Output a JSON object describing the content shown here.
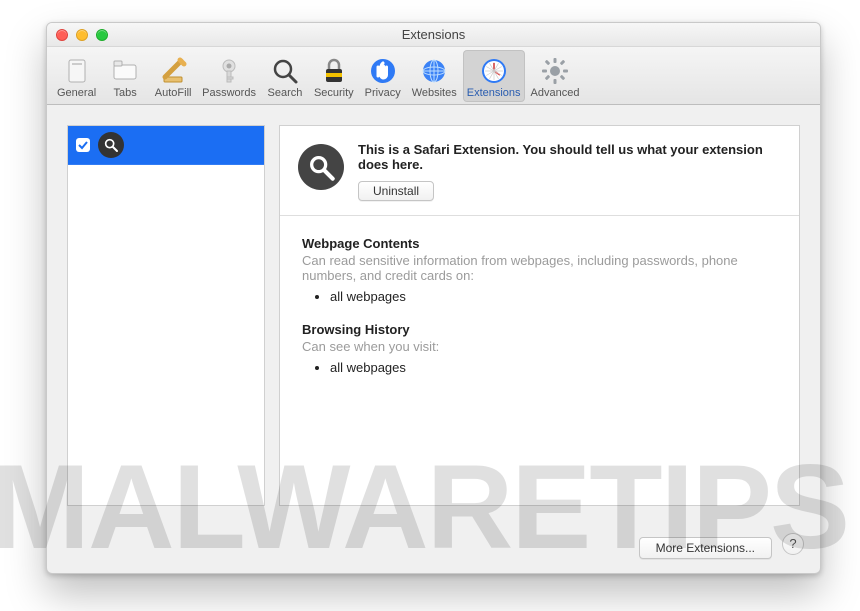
{
  "window": {
    "title": "Extensions"
  },
  "toolbar": {
    "items": [
      {
        "label": "General"
      },
      {
        "label": "Tabs"
      },
      {
        "label": "AutoFill"
      },
      {
        "label": "Passwords"
      },
      {
        "label": "Search"
      },
      {
        "label": "Security"
      },
      {
        "label": "Privacy"
      },
      {
        "label": "Websites"
      },
      {
        "label": "Extensions"
      },
      {
        "label": "Advanced"
      }
    ]
  },
  "sidebar": {
    "items": [
      {
        "checked": true,
        "icon": "search"
      }
    ]
  },
  "detail": {
    "description": "This is a Safari Extension. You should tell us what your extension does here.",
    "uninstall_label": "Uninstall",
    "sections": [
      {
        "title": "Webpage Contents",
        "subtitle": "Can read sensitive information from webpages, including passwords, phone numbers, and credit cards on:",
        "bullets": [
          "all webpages"
        ]
      },
      {
        "title": "Browsing History",
        "subtitle": "Can see when you visit:",
        "bullets": [
          "all webpages"
        ]
      }
    ]
  },
  "footer": {
    "more_label": "More Extensions...",
    "help_label": "?"
  },
  "watermark": "MALWARETIPS"
}
